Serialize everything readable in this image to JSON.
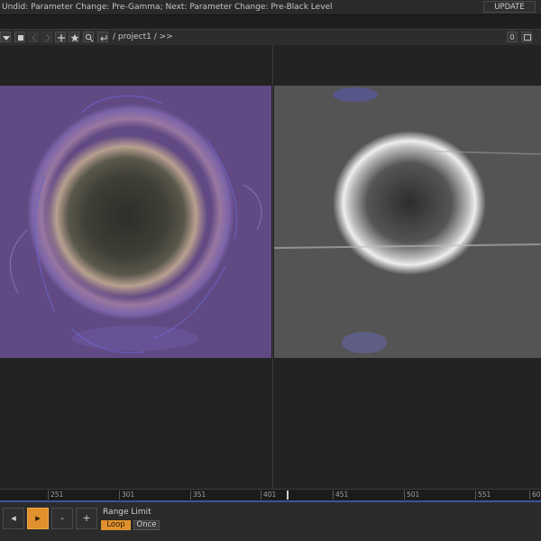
{
  "status_bar": {
    "text": "Undid: Parameter Change: Pre-Gamma; Next: Parameter Change: Pre-Black Level",
    "update_label": "UPDATE"
  },
  "toolbar": {
    "path": "/ project1 / >>",
    "zero_label": "0",
    "icons": [
      "dropdown-arrow-icon",
      "stop-icon",
      "back-icon",
      "forward-icon",
      "plus-icon",
      "star-icon",
      "search-icon",
      "return-icon"
    ]
  },
  "timeline": {
    "ticks": [
      "251",
      "301",
      "351",
      "401",
      "451",
      "501",
      "551",
      "60"
    ]
  },
  "controls": {
    "play_label": "▸",
    "prev_label": "◂",
    "minus_label": "-",
    "plus_label": "+",
    "range_limit_label": "Range Limit",
    "loop_label": "Loop",
    "once_label": "Once",
    "active_mode": "Loop"
  },
  "colors": {
    "accent": "#e0912e",
    "timeline_bar": "#3a55a0",
    "background": "#222222"
  }
}
